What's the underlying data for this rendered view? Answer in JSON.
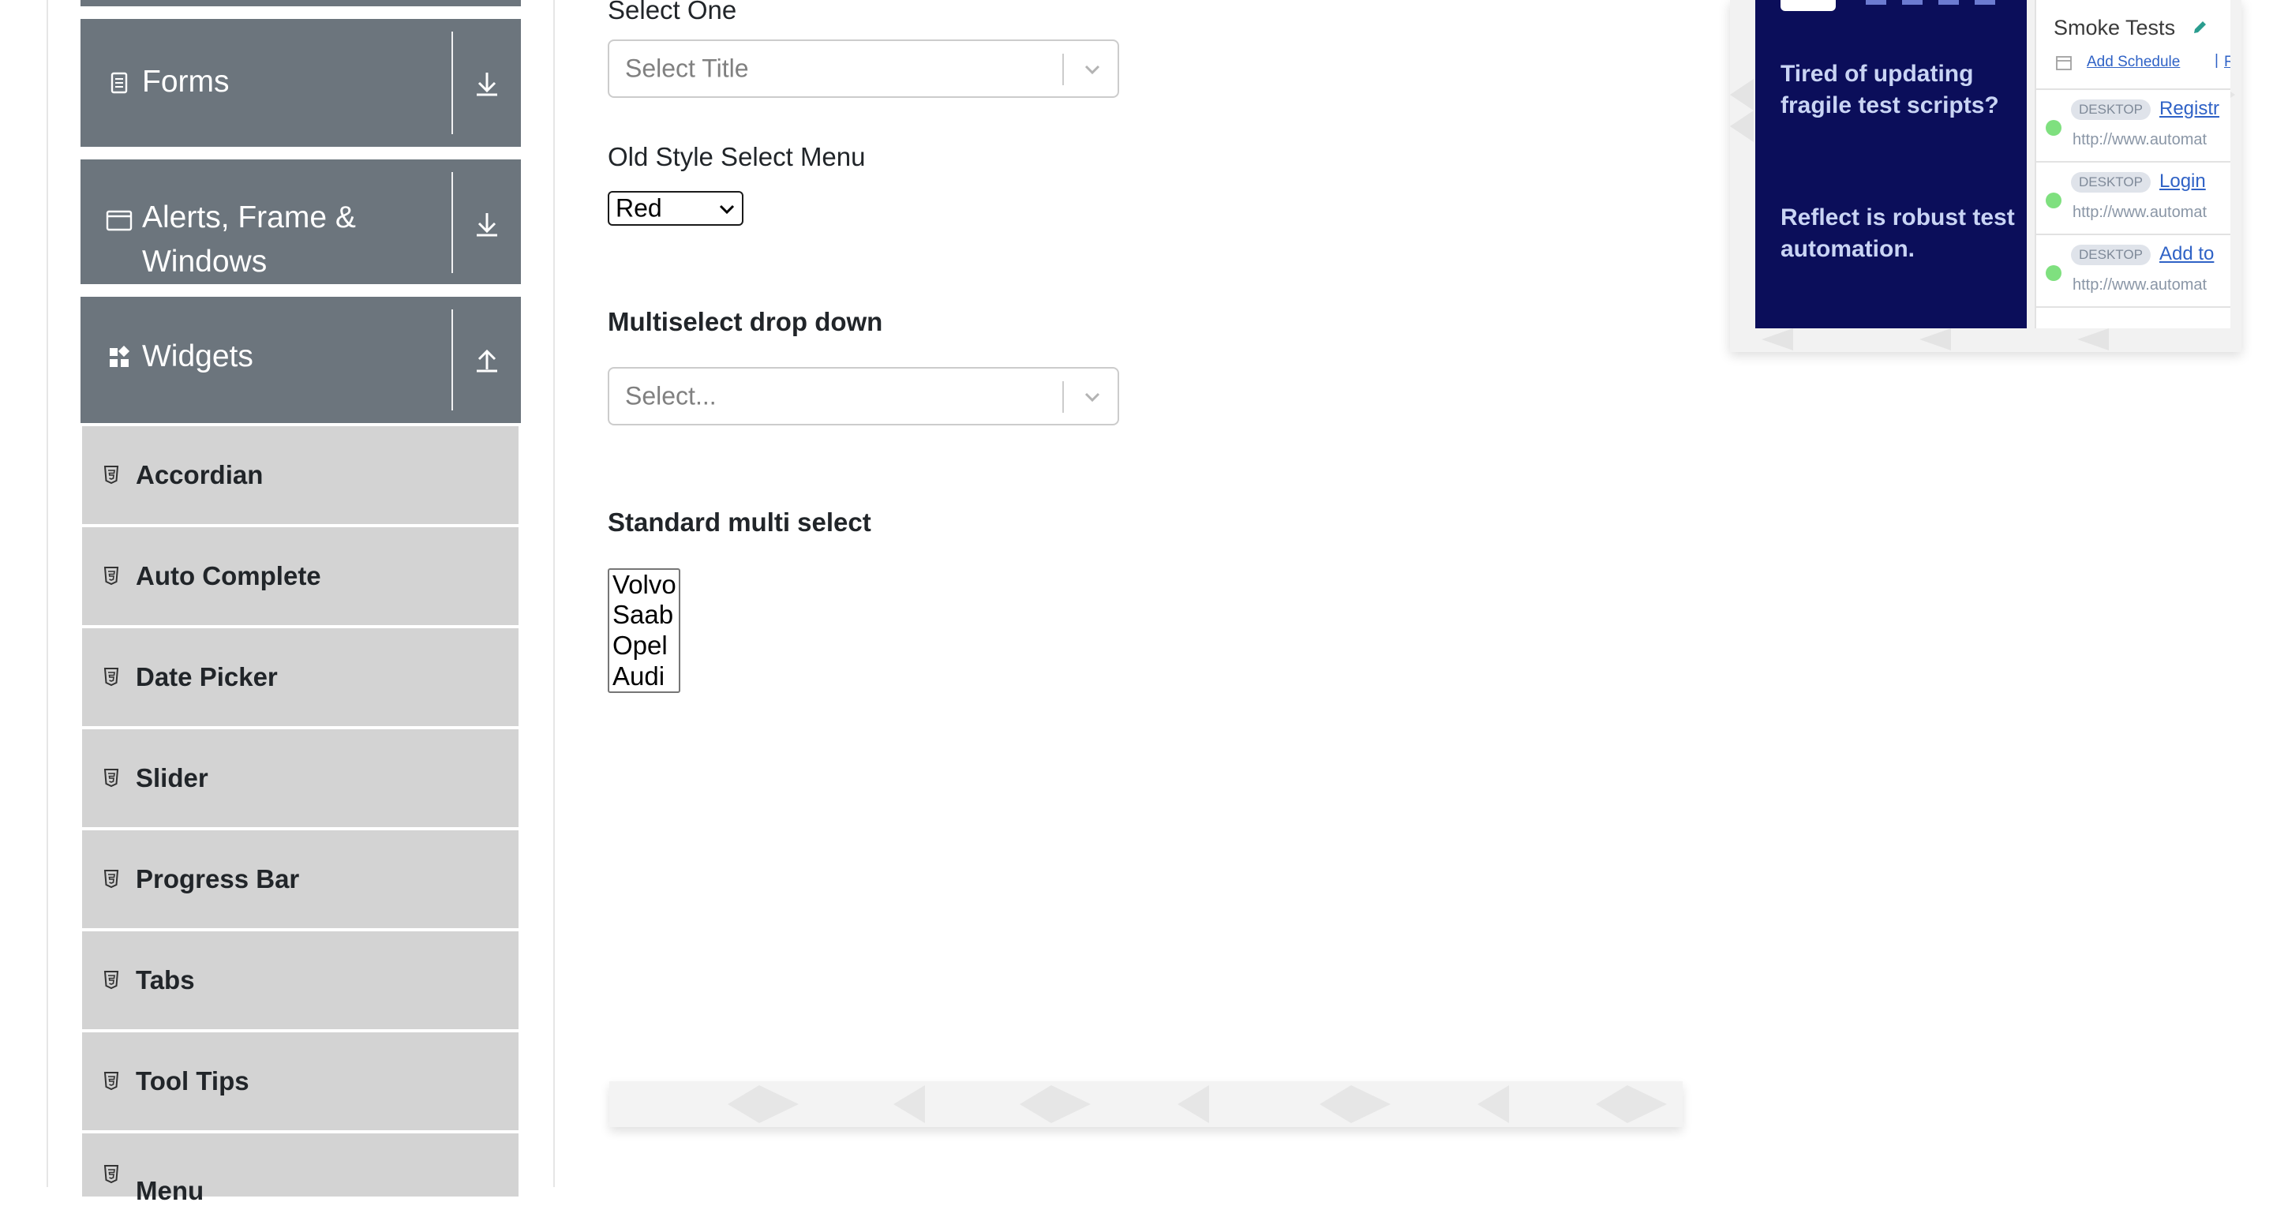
{
  "sidebar": {
    "groups": [
      {
        "label": "Forms",
        "icon": "document-icon",
        "toggle": "download-arrow-icon"
      },
      {
        "label": "Alerts, Frame &",
        "label_line2": "Windows",
        "icon": "window-icon",
        "toggle": "download-arrow-icon"
      },
      {
        "label": "Widgets",
        "icon": "widgets-icon",
        "toggle": "upload-arrow-icon"
      }
    ],
    "items": [
      {
        "label": "Accordian",
        "icon": "html5-icon"
      },
      {
        "label": "Auto Complete",
        "icon": "html5-icon"
      },
      {
        "label": "Date Picker",
        "icon": "html5-icon"
      },
      {
        "label": "Slider",
        "icon": "html5-icon"
      },
      {
        "label": "Progress Bar",
        "icon": "html5-icon"
      },
      {
        "label": "Tabs",
        "icon": "html5-icon"
      },
      {
        "label": "Tool Tips",
        "icon": "html5-icon"
      },
      {
        "label": "Menu",
        "icon": "html5-icon"
      }
    ]
  },
  "main": {
    "select_one_label": "Select One",
    "select_title_placeholder": "Select Title",
    "old_style_label": "Old Style Select Menu",
    "old_style_value": "Red",
    "multiselect_label": "Multiselect drop down",
    "multiselect_placeholder": "Select...",
    "standard_multi_label": "Standard multi select",
    "standard_multi_options": [
      "Volvo",
      "Saab",
      "Opel",
      "Audi"
    ]
  },
  "ad": {
    "tagline1": "Tired of updating fragile test scripts?",
    "tagline2": "Reflect is robust test automation.",
    "suite_title": "Smoke Tests",
    "add_schedule": "Add Schedule",
    "separator": "|",
    "run_link": "Ru",
    "tests": [
      {
        "badge": "DESKTOP",
        "name": "Registr",
        "url": "http://www.automat"
      },
      {
        "badge": "DESKTOP",
        "name": "Login",
        "url": "http://www.automat"
      },
      {
        "badge": "DESKTOP",
        "name": "Add to",
        "url": "http://www.automat"
      }
    ]
  },
  "colors": {
    "group_header_bg": "#6c757d",
    "menu_item_bg": "#d3d3d3",
    "ad_dark_bg": "#0b0e5a",
    "link_blue": "#2f62c6",
    "status_green": "#7fe07f"
  }
}
